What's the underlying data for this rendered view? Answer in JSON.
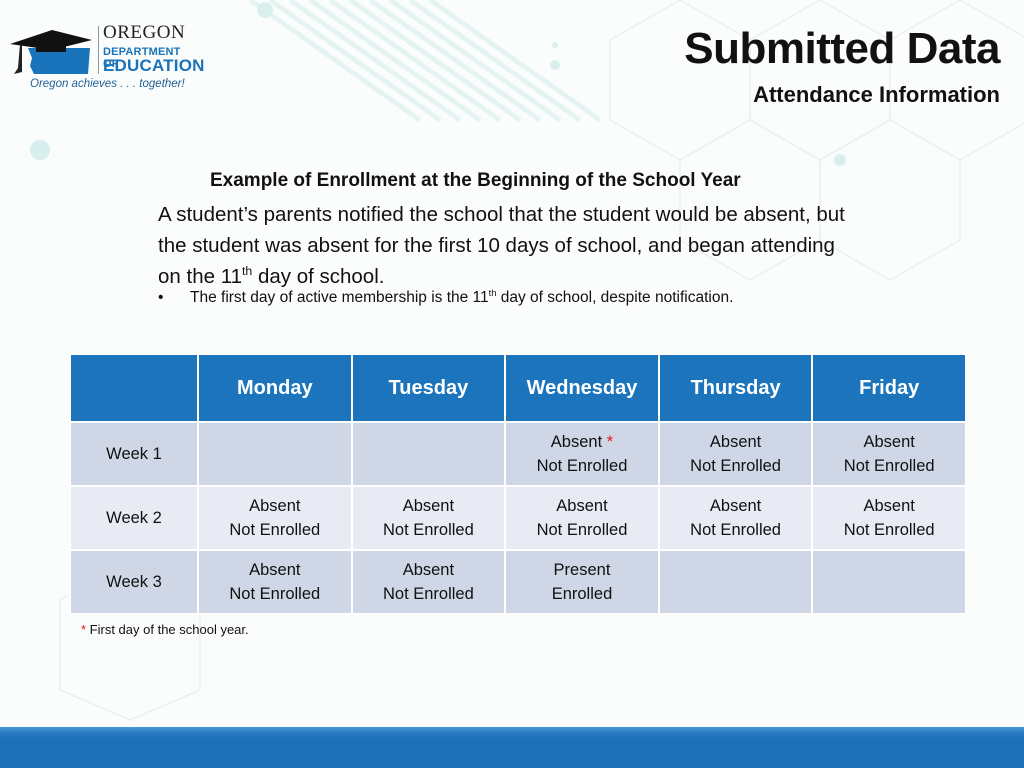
{
  "logo": {
    "line1": "OREGON",
    "line2": "DEPARTMENT OF",
    "line3": "EDUCATION",
    "tagline": "Oregon achieves . . . together!",
    "brand_color": "#1a74bb"
  },
  "header": {
    "title": "Submitted Data",
    "subtitle": "Attendance Information"
  },
  "content": {
    "heading": "Example of Enrollment at the Beginning of the School Year",
    "paragraph_part1": "A student’s parents notified the school that the student would be absent, but the student was absent for the first 10 days of school, and began attending on the 11",
    "paragraph_sup": "th",
    "paragraph_part2": " day of school.",
    "bullet_marker": "•",
    "bullet_part1": "The first day of active membership is the 11",
    "bullet_sup": "th",
    "bullet_part2": " day of school, despite notification."
  },
  "table": {
    "header_color": "#1c75bc",
    "columns": [
      "",
      "Monday",
      "Tuesday",
      "Wednesday",
      "Thursday",
      "Friday"
    ],
    "rows": [
      {
        "label": "Week 1",
        "cells": [
          {
            "status": "",
            "enrollment": "",
            "star": ""
          },
          {
            "status": "",
            "enrollment": "",
            "star": ""
          },
          {
            "status": "Absent",
            "enrollment": "Not Enrolled",
            "star": "*"
          },
          {
            "status": "Absent",
            "enrollment": "Not Enrolled",
            "star": ""
          },
          {
            "status": "Absent",
            "enrollment": "Not Enrolled",
            "star": ""
          }
        ]
      },
      {
        "label": "Week 2",
        "cells": [
          {
            "status": "Absent",
            "enrollment": "Not Enrolled",
            "star": ""
          },
          {
            "status": "Absent",
            "enrollment": "Not Enrolled",
            "star": ""
          },
          {
            "status": "Absent",
            "enrollment": "Not Enrolled",
            "star": ""
          },
          {
            "status": "Absent",
            "enrollment": "Not Enrolled",
            "star": ""
          },
          {
            "status": "Absent",
            "enrollment": "Not Enrolled",
            "star": ""
          }
        ]
      },
      {
        "label": "Week 3",
        "cells": [
          {
            "status": "Absent",
            "enrollment": "Not Enrolled",
            "star": ""
          },
          {
            "status": "Absent",
            "enrollment": "Not Enrolled",
            "star": ""
          },
          {
            "status": "Present",
            "enrollment": "Enrolled",
            "star": ""
          },
          {
            "status": "",
            "enrollment": "",
            "star": ""
          },
          {
            "status": "",
            "enrollment": "",
            "star": ""
          }
        ]
      }
    ]
  },
  "footnote": {
    "marker": "*",
    "text": " First day of the school year."
  }
}
